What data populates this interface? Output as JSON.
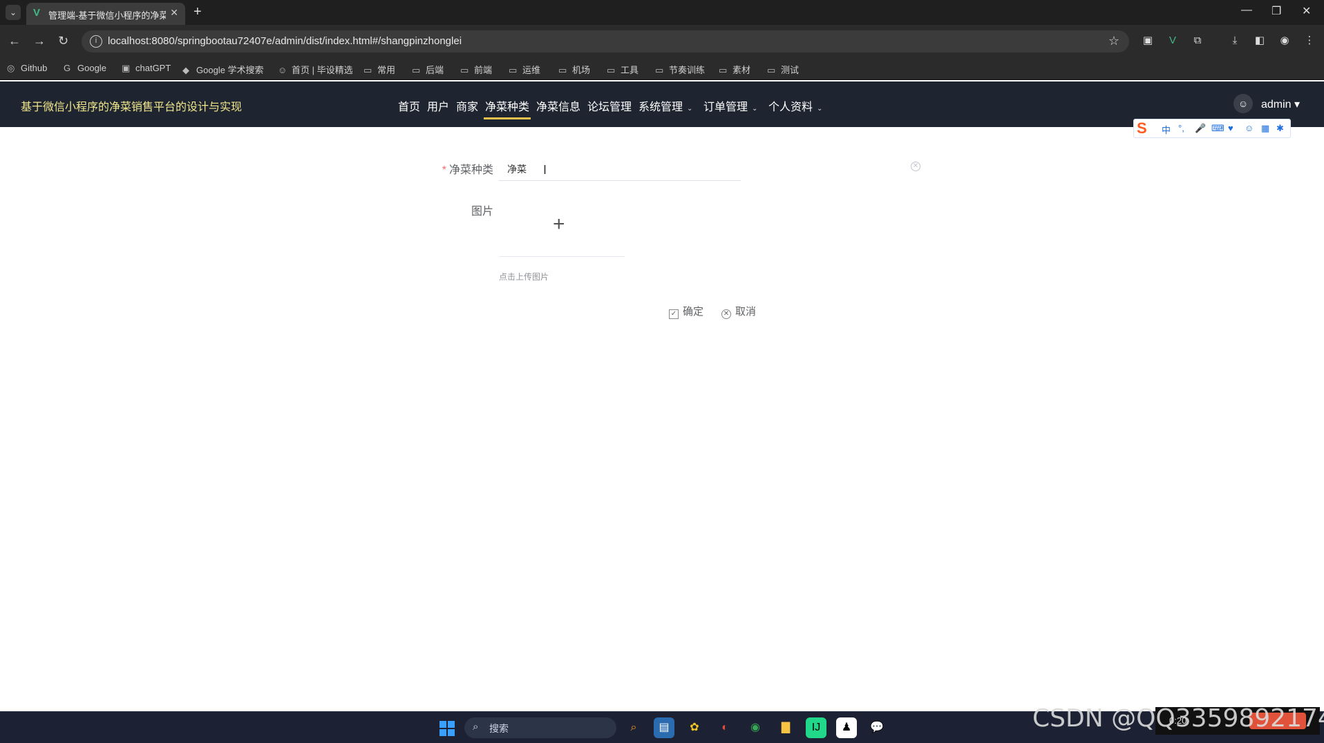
{
  "browser": {
    "tab_title": "管理端-基于微信小程序的净菜...",
    "url": "localhost:8080/springbootau72407e/admin/dist/index.html#/shangpinzhonglei",
    "bookmarks": [
      {
        "label": "Github",
        "icon": "github-icon"
      },
      {
        "label": "Google",
        "icon": "google-icon"
      },
      {
        "label": "chatGPT",
        "icon": "chatgpt-icon"
      },
      {
        "label": "Google 学术搜索",
        "icon": "scholar-icon"
      },
      {
        "label": "首页 | 毕设精选",
        "icon": "site-icon"
      },
      {
        "label": "常用",
        "icon": "folder-icon"
      },
      {
        "label": "后端",
        "icon": "folder-icon"
      },
      {
        "label": "前端",
        "icon": "folder-icon"
      },
      {
        "label": "运维",
        "icon": "folder-icon"
      },
      {
        "label": "机场",
        "icon": "folder-icon"
      },
      {
        "label": "工具",
        "icon": "folder-icon"
      },
      {
        "label": "节奏训练",
        "icon": "folder-icon"
      },
      {
        "label": "素材",
        "icon": "folder-icon"
      },
      {
        "label": "测试",
        "icon": "folder-icon"
      }
    ]
  },
  "app": {
    "name": "基于微信小程序的净菜销售平台的设计与实现",
    "menu": [
      {
        "label": "首页"
      },
      {
        "label": "用户"
      },
      {
        "label": "商家"
      },
      {
        "label": "净菜种类",
        "active": true
      },
      {
        "label": "净菜信息"
      },
      {
        "label": "论坛管理"
      },
      {
        "label": "系统管理",
        "dropdown": true
      },
      {
        "label": "订单管理",
        "dropdown": true
      },
      {
        "label": "个人资料",
        "dropdown": true
      }
    ],
    "user": "admin"
  },
  "form": {
    "category_label": "净菜种类",
    "category_value": "净菜",
    "image_label": "图片",
    "upload_tip": "点击上传图片",
    "confirm_label": "确定",
    "cancel_label": "取消"
  },
  "ime": {
    "mode": "中"
  },
  "taskbar": {
    "search_placeholder": "搜索"
  },
  "tray": {
    "time": "0:20"
  },
  "watermark": "CSDN @QQ3359892174",
  "colors": {
    "header_bg": "#1f2530",
    "app_title": "#f0e68c",
    "active_underline": "#f0c14b",
    "required": "#f56c6c"
  }
}
